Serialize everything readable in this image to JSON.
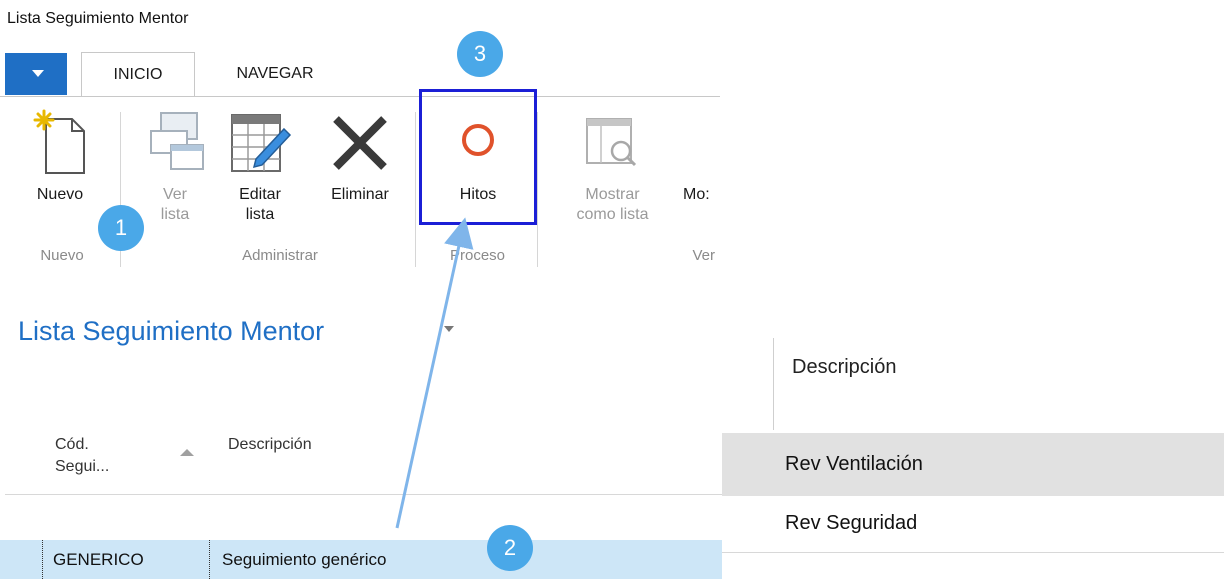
{
  "window": {
    "title": "Lista Seguimiento Mentor"
  },
  "tabs": [
    {
      "label": "INICIO"
    },
    {
      "label": "NAVEGAR"
    }
  ],
  "ribbon": {
    "nuevo": {
      "line1": "Nuevo"
    },
    "ver_lista": {
      "line1": "Ver",
      "line2": "lista"
    },
    "editar_lista": {
      "line1": "Editar",
      "line2": "lista"
    },
    "eliminar": {
      "line1": "Eliminar"
    },
    "hitos": {
      "line1": "Hitos"
    },
    "mostrar_como_lista": {
      "line1": "Mostrar",
      "line2": "como lista"
    },
    "mostrar_partial": {
      "line1": "Mo:"
    },
    "groups": {
      "nuevo": "Nuevo",
      "administrar": "Administrar",
      "proceso": "Proceso",
      "ver": "Ver"
    }
  },
  "badges": {
    "b1": "1",
    "b2": "2",
    "b3": "3"
  },
  "page": {
    "title": "Lista Seguimiento Mentor"
  },
  "list": {
    "col_codigo_l1": "Cód.",
    "col_codigo_l2": "Segui...",
    "col_descripcion": "Descripción",
    "rows": [
      {
        "codigo": "GENERICO",
        "descripcion": "Seguimiento genérico"
      }
    ]
  },
  "right_panel": {
    "header": "Descripción",
    "rows": [
      {
        "text": "Rev Ventilación"
      },
      {
        "text": "Rev Seguridad"
      }
    ]
  },
  "colors": {
    "accent": "#1f6fc5",
    "badge": "#4aa8e8",
    "highlight_box": "#1b1fd6",
    "hitos_icon": "#e0522b",
    "selected_row": "#cde6f7"
  }
}
